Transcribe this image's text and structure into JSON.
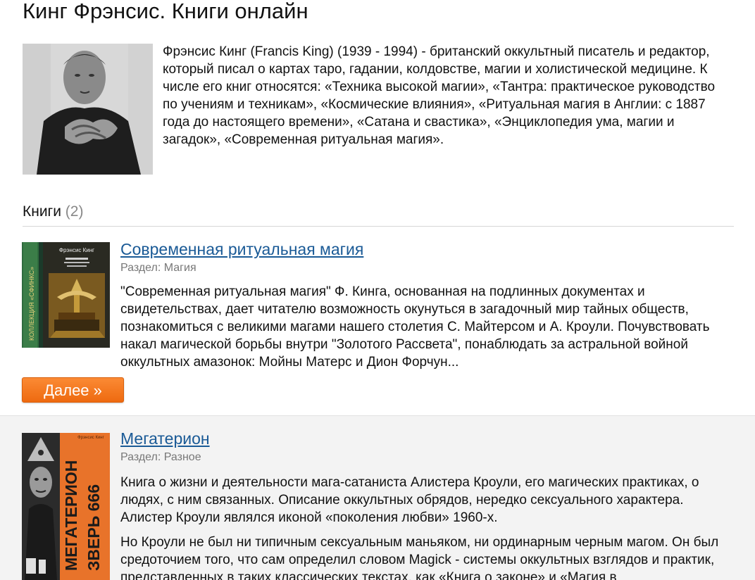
{
  "page": {
    "title": "Кинг Фрэнсис. Книги онлайн"
  },
  "author": {
    "bio": "Фрэнсис Кинг (Francis King) (1939 - 1994) - британский оккультный писатель и редактор, который писал о картах таро, гадании, колдовстве, магии и холистической медицине. К числе его книг относятся: «Техника высокой магии», «Тантра: практическое руководство по учениям и техникам», «Космические влияния», «Ритуальная магия в Англии: с 1887 года до настоящего времени», «Сатана и свастика», «Энциклопедия ума, магии и загадок», «Современная ритуальная магия»."
  },
  "books_section": {
    "heading": "Книги",
    "count": "(2)"
  },
  "books": [
    {
      "title": "Современная ритуальная магия",
      "section": "Раздел: Магия",
      "description": [
        "\"Современная ритуальная магия\" Ф. Кинга, основанная на подлинных документах и свидетельствах, дает читателю возможность окунуться в загадочный мир тайных обществ, познакомиться с великими магами нашего столетия С. Майтерсом и А. Кроули. Почувствовать накал магической борьбы внутри \"Золотого Рассвета\", понаблюдать за астральной войной оккультных амазонок: Мойны Матерс и Дион Форчун..."
      ],
      "cover_text": {
        "series": "КОЛЛЕКЦИЯ «СФИНКС»",
        "author": "Фрэнсис Кинг"
      },
      "more_label": "Далее »"
    },
    {
      "title": "Мегатерион",
      "section": "Раздел: Разное",
      "description": [
        "Книга о жизни и деятельности мага-сатаниста Алистера Кроули, его магических практиках, о людях, с ним связанных. Описание оккультных обрядов, нередко сексуального характера. Алистер Кроули являлся иконой «поколения любви» 1960-х.",
        "Но Кроули не был ни типичным сексуальным маньяком, ни ординарным черным магом. Он был средоточием того, что сам определил словом Magick - системы оккультных взглядов и практик, представленных в таких классических текстах, как «Книга о законе» и «Магия в"
      ],
      "cover_text": {
        "title": "МЕГАТЕРИОН",
        "subtitle": "ЗВЕРЬ 666"
      }
    }
  ],
  "colors": {
    "link": "#1a5a96",
    "button": "#ee6a10",
    "muted": "#777777"
  }
}
